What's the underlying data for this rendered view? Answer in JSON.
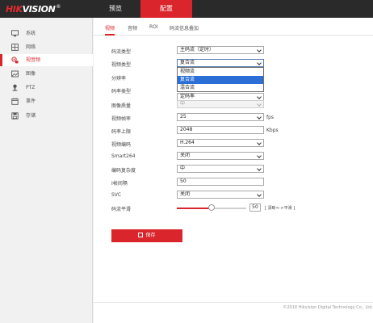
{
  "header": {
    "logo_part1": "HIK",
    "logo_part2": "VISION",
    "logo_mark": "®",
    "nav": [
      {
        "label": "预览",
        "active": false
      },
      {
        "label": "配置",
        "active": true
      }
    ]
  },
  "sidebar": {
    "items": [
      {
        "label": "系统",
        "icon": "monitor-icon"
      },
      {
        "label": "网络",
        "icon": "network-icon"
      },
      {
        "label": "视音频",
        "icon": "video-audio-icon",
        "active": true
      },
      {
        "label": "图像",
        "icon": "image-icon"
      },
      {
        "label": "PTZ",
        "icon": "ptz-icon"
      },
      {
        "label": "事件",
        "icon": "event-icon"
      },
      {
        "label": "存储",
        "icon": "storage-icon"
      }
    ]
  },
  "tabs": [
    {
      "label": "视频",
      "active": true
    },
    {
      "label": "音频"
    },
    {
      "label": "ROI"
    },
    {
      "label": "码流信息叠加"
    }
  ],
  "form": {
    "stream_type": {
      "label": "码流类型",
      "value": "主码流（定时）"
    },
    "video_type": {
      "label": "视频类型",
      "value": "复合流",
      "options": [
        "视频流",
        "复合流",
        "混合流"
      ]
    },
    "resolution": {
      "label": "分辨率"
    },
    "bitrate_type": {
      "label": "码率类型",
      "value": "定码率"
    },
    "image_quality": {
      "label": "图像质量",
      "value": "中"
    },
    "frame_rate": {
      "label": "视频帧率",
      "value": "25",
      "unit": "fps"
    },
    "bitrate_limit": {
      "label": "码率上限",
      "value": "2048",
      "unit": "Kbps"
    },
    "encoding": {
      "label": "视频编码",
      "value": "H.264"
    },
    "smart264": {
      "label": "Smart264",
      "value": "关闭"
    },
    "complexity": {
      "label": "编码复杂度",
      "value": "中"
    },
    "iframe_interval": {
      "label": "I帧间隔",
      "value": "50"
    },
    "svc": {
      "label": "SVC",
      "value": "关闭"
    },
    "smoothing": {
      "label": "码流平滑",
      "value": "50",
      "fraction": 0.5,
      "hint": "[ 清晰<->平滑 ]"
    }
  },
  "save_label": "保存",
  "footer": "©2018 Hikvision Digital Technology Co., Ltd.",
  "colors": {
    "brand_red": "#d9252b",
    "dark_header": "#2a2a2a",
    "select_blue": "#2b6fd6"
  }
}
